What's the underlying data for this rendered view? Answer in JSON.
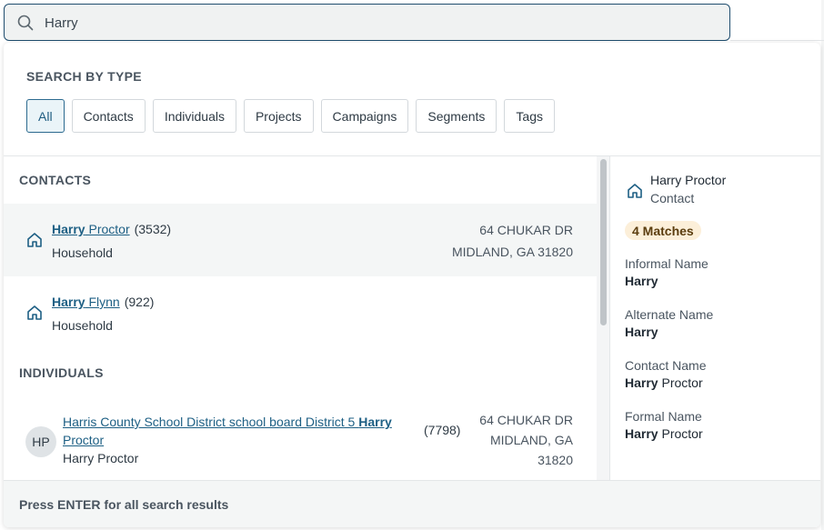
{
  "search": {
    "value": "Harry"
  },
  "search_by_type": {
    "title": "SEARCH BY TYPE",
    "chips": [
      "All",
      "Contacts",
      "Individuals",
      "Projects",
      "Campaigns",
      "Segments",
      "Tags"
    ],
    "active": "All"
  },
  "contacts": {
    "title": "CONTACTS",
    "items": [
      {
        "match": "Harry",
        "rest": " Proctor",
        "count": "(3532)",
        "type": "Household",
        "address_line1": "64 CHUKAR DR",
        "address_line2": "MIDLAND, GA 31820"
      },
      {
        "match": "Harry",
        "rest": " Flynn",
        "count": "(922)",
        "type": "Household",
        "address_line1": "",
        "address_line2": ""
      }
    ]
  },
  "individuals": {
    "title": "INDIVIDUALS",
    "items": [
      {
        "initials": "HP",
        "prefix": "Harris County School District school board District 5 ",
        "match": "Harry",
        "rest": " Proctor",
        "count": "(7798)",
        "sub": "Harry Proctor",
        "address_line1": "64 CHUKAR DR",
        "address_line2": "MIDLAND, GA",
        "address_line3": "31820"
      }
    ]
  },
  "detail": {
    "name": "Harry Proctor",
    "type": "Contact",
    "matches_badge": "4 Matches",
    "fields": [
      {
        "label": "Informal Name",
        "match": "Harry",
        "rest": ""
      },
      {
        "label": "Alternate Name",
        "match": "Harry",
        "rest": ""
      },
      {
        "label": "Contact Name",
        "match": "Harry",
        "rest": " Proctor"
      },
      {
        "label": "Formal Name",
        "match": "Harry",
        "rest": " Proctor"
      }
    ]
  },
  "footer": {
    "hint": "Press ENTER for all search results"
  },
  "colors": {
    "accent": "#1d5f84",
    "badge_bg": "#fcefd9",
    "highlight_row": "#f4f6f6"
  },
  "icons": [
    "search-icon",
    "house-icon"
  ]
}
